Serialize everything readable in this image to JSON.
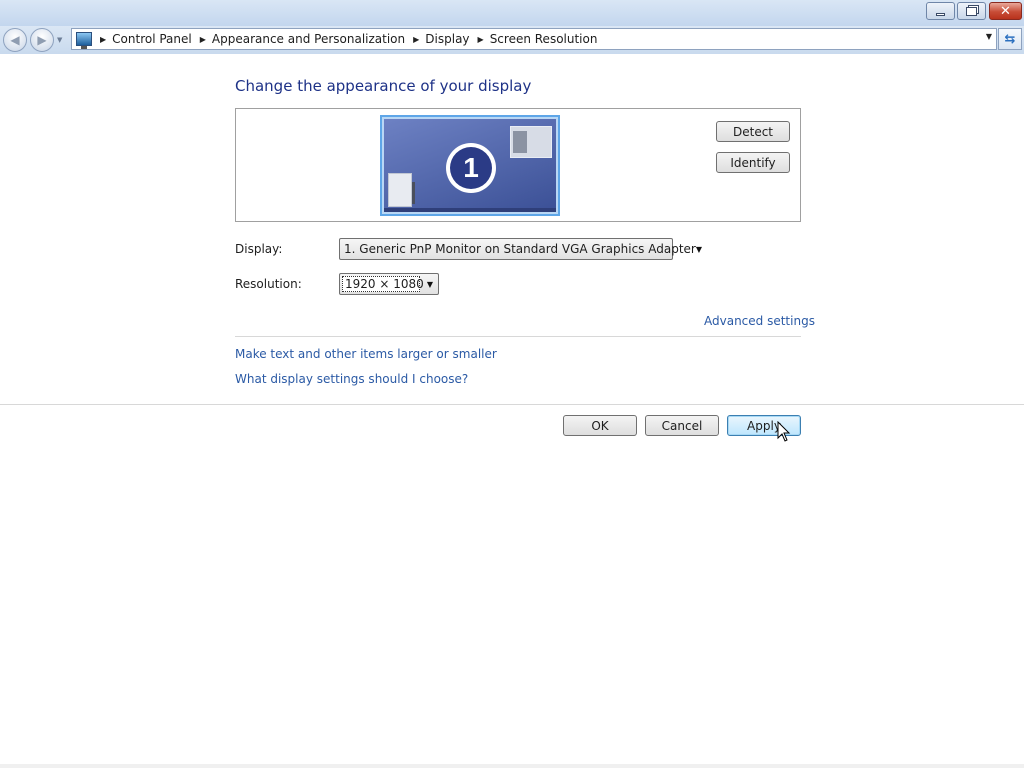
{
  "window": {
    "controls": {
      "minimize_icon": "minimize-icon",
      "maximize_icon": "restore-icon",
      "close_icon": "close-icon"
    }
  },
  "navigation": {
    "back_icon": "back-arrow-icon",
    "forward_icon": "forward-arrow-icon",
    "location_icon": "control-panel-icon",
    "breadcrumbs": [
      "Control Panel",
      "Appearance and Personalization",
      "Display",
      "Screen Resolution"
    ],
    "refresh_icon": "refresh-icon"
  },
  "main": {
    "heading": "Change the appearance of your display",
    "monitor_number": "1",
    "detect_label": "Detect",
    "identify_label": "Identify",
    "display_label": "Display:",
    "display_value": "1. Generic PnP Monitor on Standard VGA Graphics Adapter",
    "resolution_label": "Resolution:",
    "resolution_value": "1920 × 1080",
    "advanced_link": "Advanced settings",
    "links": [
      "Make text and other items larger or smaller",
      "What display settings should I choose?"
    ]
  },
  "footer": {
    "ok_label": "OK",
    "cancel_label": "Cancel",
    "apply_label": "Apply"
  },
  "colors": {
    "heading": "#1e3287",
    "link": "#2b5aa5",
    "monitor_bg": "#3a4f95",
    "monitor_border": "#5ea6e8"
  }
}
